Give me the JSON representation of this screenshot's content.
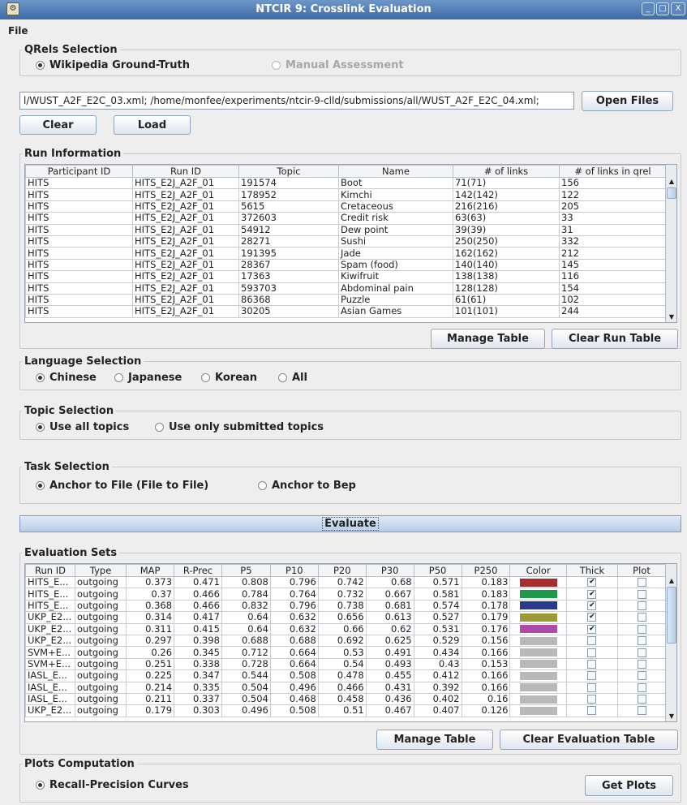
{
  "window": {
    "title": "NTCIR 9: Crosslink Evaluation",
    "minimize_glyph": "_",
    "maximize_glyph": "□",
    "close_glyph": "X"
  },
  "menubar": {
    "file": "File"
  },
  "qrels": {
    "legend": "QRels Selection",
    "options": [
      {
        "label": "Wikipedia Ground-Truth",
        "selected": true,
        "enabled": true
      },
      {
        "label": "Manual Assessment",
        "selected": false,
        "enabled": false
      }
    ]
  },
  "files": {
    "path_value": "l/WUST_A2F_E2C_03.xml; /home/monfee/experiments/ntcir-9-clld/submissions/all/WUST_A2F_E2C_04.xml;",
    "open_label": "Open Files",
    "clear_label": "Clear",
    "load_label": "Load"
  },
  "run_info": {
    "legend": "Run Information",
    "columns": [
      "Participant ID",
      "Run ID",
      "Topic",
      "Name",
      "# of links",
      "# of links in qrel"
    ],
    "rows": [
      [
        "HITS",
        "HITS_E2J_A2F_01",
        "191574",
        "Boot",
        "71(71)",
        "156"
      ],
      [
        "HITS",
        "HITS_E2J_A2F_01",
        "178952",
        "Kimchi",
        "142(142)",
        "122"
      ],
      [
        "HITS",
        "HITS_E2J_A2F_01",
        "5615",
        "Cretaceous",
        "216(216)",
        "205"
      ],
      [
        "HITS",
        "HITS_E2J_A2F_01",
        "372603",
        "Credit risk",
        "63(63)",
        "33"
      ],
      [
        "HITS",
        "HITS_E2J_A2F_01",
        "54912",
        "Dew point",
        "39(39)",
        "31"
      ],
      [
        "HITS",
        "HITS_E2J_A2F_01",
        "28271",
        "Sushi",
        "250(250)",
        "332"
      ],
      [
        "HITS",
        "HITS_E2J_A2F_01",
        "191395",
        "Jade",
        "162(162)",
        "212"
      ],
      [
        "HITS",
        "HITS_E2J_A2F_01",
        "28367",
        "Spam (food)",
        "140(140)",
        "145"
      ],
      [
        "HITS",
        "HITS_E2J_A2F_01",
        "17363",
        "Kiwifruit",
        "138(138)",
        "116"
      ],
      [
        "HITS",
        "HITS_E2J_A2F_01",
        "593703",
        "Abdominal pain",
        "128(128)",
        "154"
      ],
      [
        "HITS",
        "HITS_E2J_A2F_01",
        "86368",
        "Puzzle",
        "61(61)",
        "102"
      ],
      [
        "HITS",
        "HITS_E2J_A2F_01",
        "30205",
        "Asian Games",
        "101(101)",
        "244"
      ]
    ],
    "manage_label": "Manage Table",
    "clear_label": "Clear Run Table"
  },
  "language": {
    "legend": "Language Selection",
    "options": [
      {
        "label": "Chinese",
        "selected": true
      },
      {
        "label": "Japanese",
        "selected": false
      },
      {
        "label": "Korean",
        "selected": false
      },
      {
        "label": "All",
        "selected": false
      }
    ]
  },
  "topic": {
    "legend": "Topic Selection",
    "options": [
      {
        "label": "Use all topics",
        "selected": true
      },
      {
        "label": "Use only submitted topics",
        "selected": false
      }
    ]
  },
  "task": {
    "legend": "Task Selection",
    "options": [
      {
        "label": "Anchor to File (File to File)",
        "selected": true
      },
      {
        "label": "Anchor to Bep",
        "selected": false
      }
    ]
  },
  "evaluate_label": "Evaluate",
  "eval_sets": {
    "legend": "Evaluation Sets",
    "columns": [
      "Run ID",
      "Type",
      "MAP",
      "R-Prec",
      "P5",
      "P10",
      "P20",
      "P30",
      "P50",
      "P250",
      "Color",
      "Thick",
      "Plot"
    ],
    "rows": [
      {
        "run": "HITS_E...",
        "type": "outgoing",
        "vals": [
          "0.373",
          "0.471",
          "0.808",
          "0.796",
          "0.742",
          "0.68",
          "0.571",
          "0.183"
        ],
        "color": "#a82e2e",
        "thick": true,
        "plot": false
      },
      {
        "run": "HITS_E...",
        "type": "outgoing",
        "vals": [
          "0.37",
          "0.466",
          "0.784",
          "0.764",
          "0.732",
          "0.667",
          "0.581",
          "0.183"
        ],
        "color": "#1f9a4a",
        "thick": true,
        "plot": false
      },
      {
        "run": "HITS_E...",
        "type": "outgoing",
        "vals": [
          "0.368",
          "0.466",
          "0.832",
          "0.796",
          "0.738",
          "0.681",
          "0.574",
          "0.178"
        ],
        "color": "#2b3a8e",
        "thick": true,
        "plot": false
      },
      {
        "run": "UKP_E2...",
        "type": "outgoing",
        "vals": [
          "0.314",
          "0.417",
          "0.64",
          "0.632",
          "0.656",
          "0.613",
          "0.527",
          "0.179"
        ],
        "color": "#9d9a35",
        "thick": true,
        "plot": false
      },
      {
        "run": "UKP_E2...",
        "type": "outgoing",
        "vals": [
          "0.311",
          "0.415",
          "0.64",
          "0.632",
          "0.66",
          "0.62",
          "0.531",
          "0.176"
        ],
        "color": "#b04aa8",
        "thick": true,
        "plot": false
      },
      {
        "run": "UKP_E2...",
        "type": "outgoing",
        "vals": [
          "0.297",
          "0.398",
          "0.688",
          "0.688",
          "0.692",
          "0.625",
          "0.529",
          "0.156"
        ],
        "color": "#b8b8b8",
        "thick": false,
        "plot": false
      },
      {
        "run": "SVM+E...",
        "type": "outgoing",
        "vals": [
          "0.26",
          "0.345",
          "0.712",
          "0.664",
          "0.53",
          "0.491",
          "0.434",
          "0.166"
        ],
        "color": "#b8b8b8",
        "thick": false,
        "plot": false
      },
      {
        "run": "SVM+E...",
        "type": "outgoing",
        "vals": [
          "0.251",
          "0.338",
          "0.728",
          "0.664",
          "0.54",
          "0.493",
          "0.43",
          "0.153"
        ],
        "color": "#b8b8b8",
        "thick": false,
        "plot": false
      },
      {
        "run": "IASL_E...",
        "type": "outgoing",
        "vals": [
          "0.225",
          "0.347",
          "0.544",
          "0.508",
          "0.478",
          "0.455",
          "0.412",
          "0.166"
        ],
        "color": "#b8b8b8",
        "thick": false,
        "plot": false
      },
      {
        "run": "IASL_E...",
        "type": "outgoing",
        "vals": [
          "0.214",
          "0.335",
          "0.504",
          "0.496",
          "0.466",
          "0.431",
          "0.392",
          "0.166"
        ],
        "color": "#b8b8b8",
        "thick": false,
        "plot": false
      },
      {
        "run": "IASL_E...",
        "type": "outgoing",
        "vals": [
          "0.211",
          "0.337",
          "0.504",
          "0.468",
          "0.458",
          "0.436",
          "0.402",
          "0.16"
        ],
        "color": "#b8b8b8",
        "thick": false,
        "plot": false
      },
      {
        "run": "UKP_E2...",
        "type": "outgoing",
        "vals": [
          "0.179",
          "0.303",
          "0.496",
          "0.508",
          "0.51",
          "0.467",
          "0.407",
          "0.126"
        ],
        "color": "#b8b8b8",
        "thick": false,
        "plot": false
      }
    ],
    "manage_label": "Manage Table",
    "clear_label": "Clear Evaluation Table"
  },
  "plots": {
    "legend": "Plots Computation",
    "option": {
      "label": "Recall-Precision Curves",
      "selected": true
    },
    "get_label": "Get Plots"
  }
}
